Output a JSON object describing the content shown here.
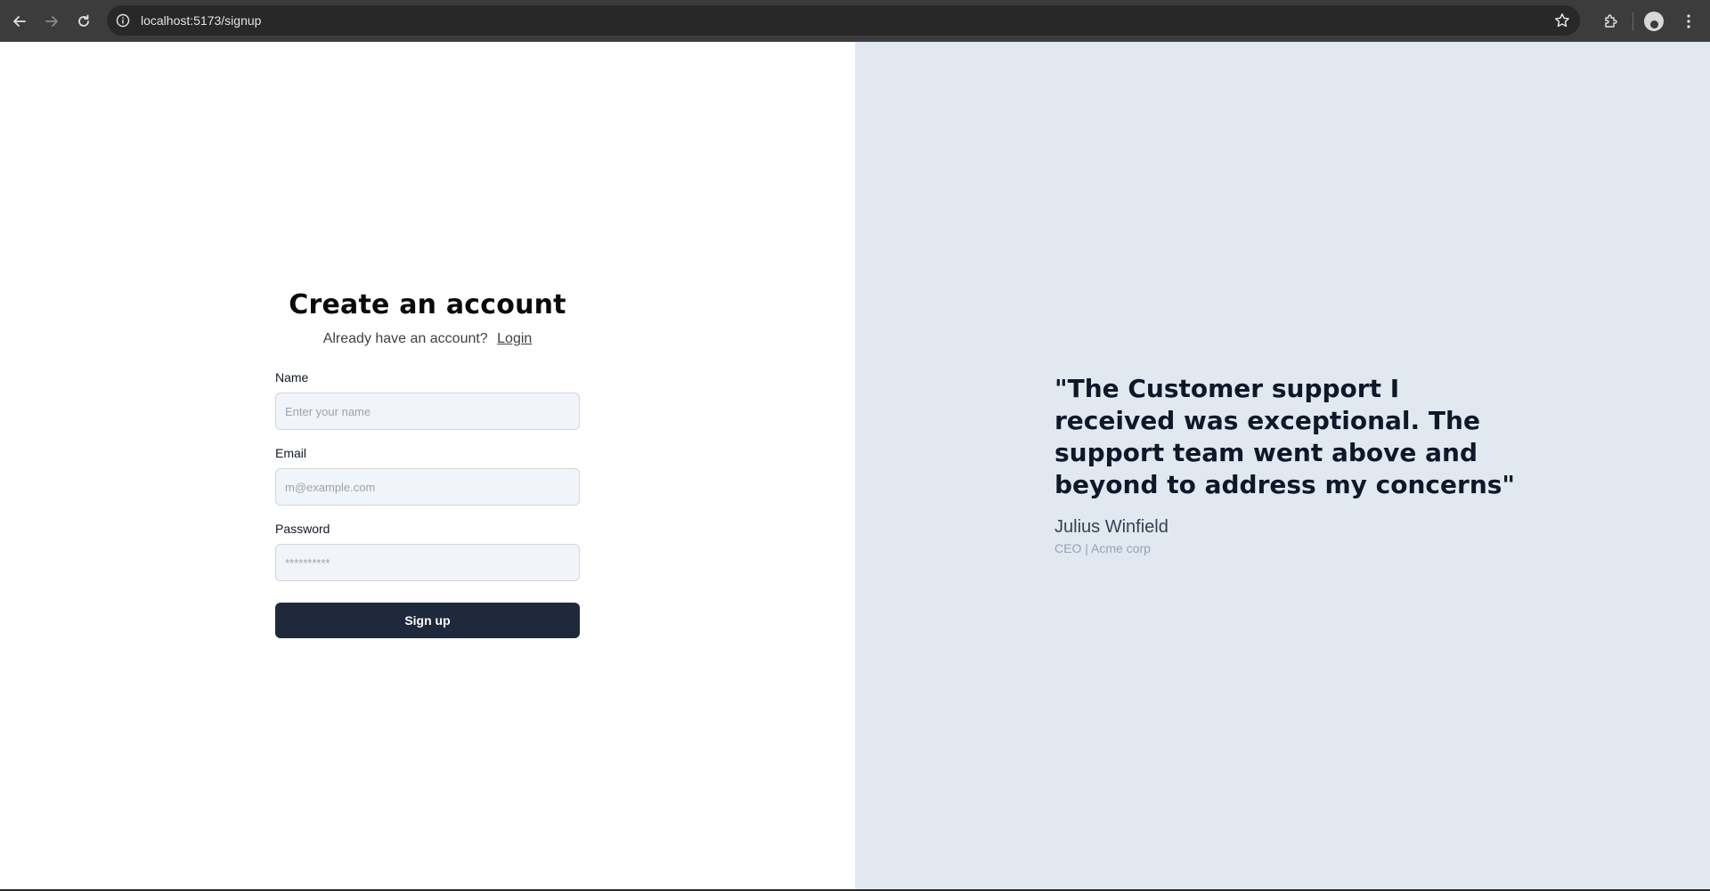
{
  "browser": {
    "url": "localhost:5173/signup",
    "icons": {
      "back": "arrow-left-icon",
      "forward": "arrow-right-icon",
      "reload": "reload-icon",
      "info": "info-icon",
      "bookmark": "star-icon",
      "extensions": "puzzle-icon",
      "profile": "avatar",
      "menu": "kebab-menu-icon"
    }
  },
  "form": {
    "title": "Create an account",
    "subtitle": "Already have an account?",
    "login_link": "Login",
    "name": {
      "label": "Name",
      "placeholder": "Enter your name",
      "value": ""
    },
    "email": {
      "label": "Email",
      "placeholder": "m@example.com",
      "value": ""
    },
    "password": {
      "label": "Password",
      "placeholder": "**********",
      "value": ""
    },
    "submit_label": "Sign up"
  },
  "testimonial": {
    "quote": "\"The Customer support I received was exceptional. The support team went above and beyond to address my concerns\"",
    "author": "Julius Winfield",
    "role": "CEO | Acme corp"
  },
  "colors": {
    "chrome_bg": "#3c3c3c",
    "omnibox_bg": "#282828",
    "right_pane_bg": "#e2e8f0",
    "button_bg": "#1e293b",
    "input_bg": "#f1f5f9"
  }
}
